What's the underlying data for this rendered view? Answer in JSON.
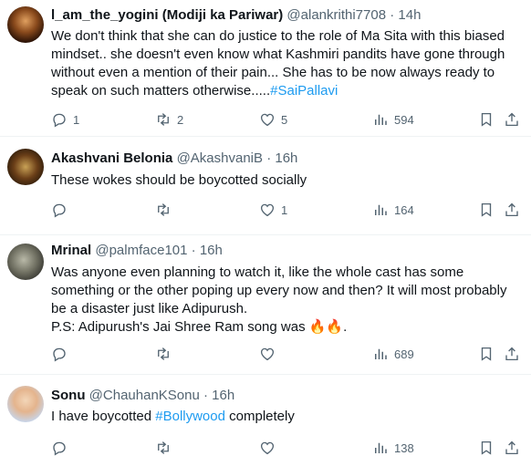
{
  "tweets": [
    {
      "name": "l_am_the_yogini (Modiji ka Pariwar)",
      "handle": "@alankrithi7708",
      "time": "14h",
      "lines": [
        {
          "text": "We don't think that she can do justice to the role of Ma Sita with this biased"
        },
        {
          "text": "mindset..  she doesn't even know what Kashmiri pandits have gone through"
        },
        {
          "text": "without even a mention of their pain... She has to be now always ready to"
        },
        {
          "text": "speak on such  matters otherwise.....",
          "hashtag": "#SaiPallavi"
        }
      ],
      "replies": "1",
      "retweets": "2",
      "likes": "5",
      "views": "594"
    },
    {
      "name": "Akashvani Belonia",
      "handle": "@AkashvaniB",
      "time": "16h",
      "lines": [
        {
          "text": "These wokes should be boycotted socially"
        }
      ],
      "replies": "",
      "retweets": "",
      "likes": "1",
      "views": "164"
    },
    {
      "name": "Mrinal",
      "handle": "@palmface101",
      "time": "16h",
      "lines": [
        {
          "text": "Was anyone even planning to watch it, like the whole cast has some"
        },
        {
          "text": "something or the other poping up every now and then? It will most probably"
        },
        {
          "text": "be a disaster just like Adipurush."
        },
        {
          "text": "P.S: Adipurush's Jai Shree Ram song was ",
          "emoji": "🔥🔥",
          "after": "."
        }
      ],
      "replies": "",
      "retweets": "",
      "likes": "",
      "views": "689"
    },
    {
      "name": "Sonu",
      "handle": "@ChauhanKSonu",
      "time": "16h",
      "lines": [
        {
          "text": "I have boycotted ",
          "hashtag": "#Bollywood",
          "after": " completely"
        }
      ],
      "replies": "",
      "retweets": "",
      "likes": "",
      "views": "138"
    }
  ],
  "separator": "·",
  "icons": {
    "reply": "reply-icon",
    "retweet": "retweet-icon",
    "like": "heart-icon",
    "views": "views-icon",
    "bookmark": "bookmark-icon",
    "share": "share-icon"
  },
  "colors": {
    "text": "#0f1419",
    "secondary": "#536471",
    "link": "#1d9bf0",
    "divider": "#eff3f4"
  }
}
